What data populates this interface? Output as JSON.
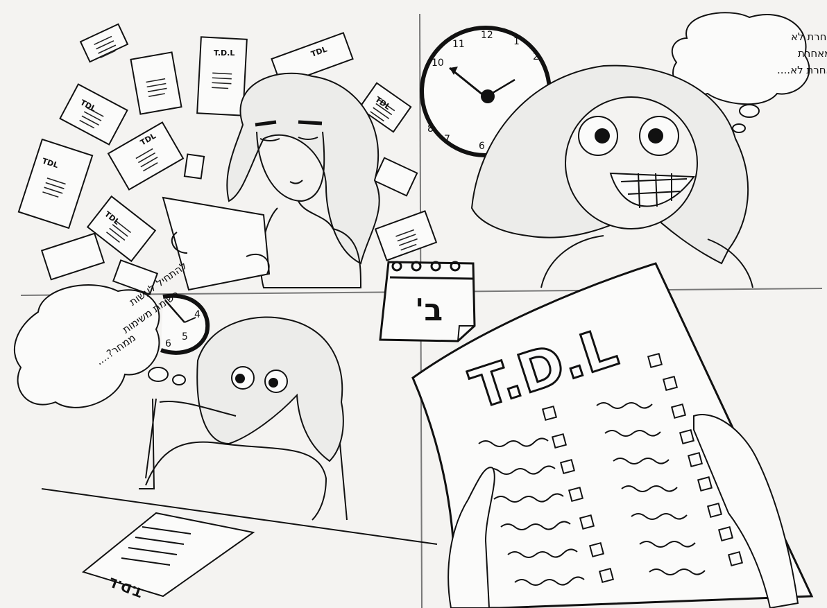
{
  "panel1": {
    "paper_label": "T.D.L",
    "paper_label_alt": "TDL"
  },
  "panel2": {
    "thought_lines": [
      "לא מאחרת לא",
      "מאחרת לא מאחרת",
      "לא מאחרת לא...."
    ],
    "clock_numbers": [
      "12",
      "1",
      "2",
      "11",
      "10",
      "8",
      "7",
      "6"
    ]
  },
  "calendar": {
    "letter": "ב'"
  },
  "panel3": {
    "thought_lines": [
      "להתחיל לעשות",
      "רשימת משימות",
      "ממחר?...."
    ],
    "clock_numbers": [
      "4",
      "5",
      "6"
    ],
    "desk_paper_label": "T.D.L"
  },
  "panel4": {
    "big_title": "T.D.L"
  }
}
